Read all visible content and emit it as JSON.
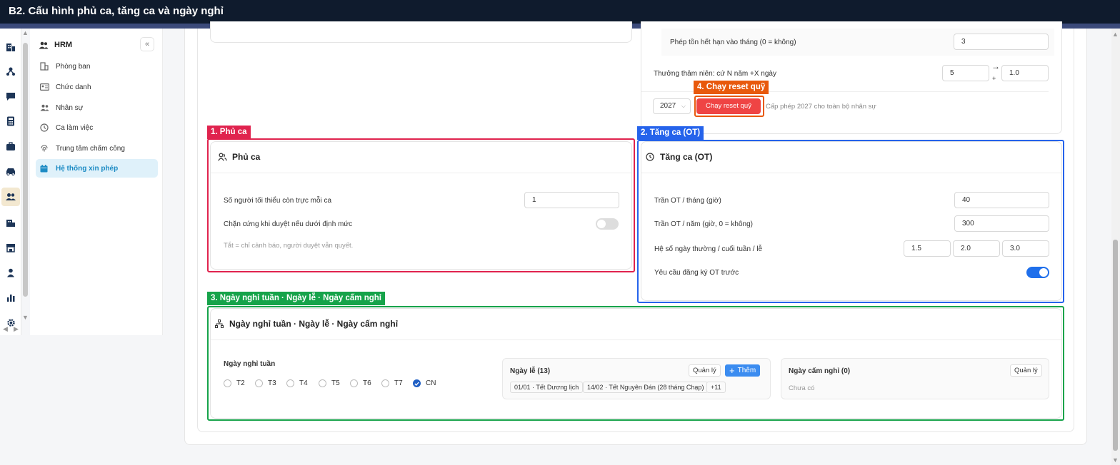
{
  "window": {
    "title": "B2. Cấu hình phủ ca, tăng ca và ngày nghỉ"
  },
  "sidebar": {
    "header": "HRM",
    "items": [
      {
        "label": "Phòng ban"
      },
      {
        "label": "Chức danh"
      },
      {
        "label": "Nhân sự"
      },
      {
        "label": "Ca làm việc"
      },
      {
        "label": "Trung tâm chấm công"
      },
      {
        "label": "Hệ thống xin phép"
      }
    ]
  },
  "top_section": {
    "expire_label": "Phép tồn hết hạn vào tháng (0 = không)",
    "expire_value": "3",
    "seniority_label": "Thưởng thâm niên: cứ N năm +X ngày",
    "seniority_n": "5",
    "seniority_x": "1.0",
    "arrow_symbol": "→",
    "plus_symbol": "+",
    "year_select": "2027",
    "reset_button": "Chạy reset quỹ",
    "reset_hint": "Cấp phép 2027 cho toàn bộ nhân sự"
  },
  "annotations": {
    "a1": "1. Phủ ca",
    "a2": "2. Tăng ca (OT)",
    "a3": "3. Ngày nghỉ tuần · Ngày lễ · Ngày cấm nghỉ",
    "a4": "4. Chạy reset quỹ"
  },
  "coverage": {
    "title": "Phủ ca",
    "min_people_label": "Số người tối thiểu còn trực mỗi ca",
    "min_people_value": "1",
    "hard_block_label": "Chặn cứng khi duyệt nếu dưới định mức",
    "hard_block_on": false,
    "hint": "Tắt = chỉ cảnh báo, người duyệt vẫn quyết."
  },
  "overtime": {
    "title": "Tăng ca (OT)",
    "month_cap_label": "Trần OT / tháng (giờ)",
    "month_cap_value": "40",
    "year_cap_label": "Trần OT / năm (giờ, 0 = không)",
    "year_cap_value": "300",
    "coef_label": "Hệ số ngày thường / cuối tuần / lễ",
    "coef_weekday": "1.5",
    "coef_weekend": "2.0",
    "coef_holiday": "3.0",
    "require_label": "Yêu cầu đăng ký OT trước",
    "require_on": true
  },
  "holidays": {
    "title": "Ngày nghỉ tuần · Ngày lễ · Ngày cấm nghỉ",
    "weekly_label": "Ngày nghỉ tuần",
    "days": [
      {
        "label": "T2",
        "checked": false
      },
      {
        "label": "T3",
        "checked": false
      },
      {
        "label": "T4",
        "checked": false
      },
      {
        "label": "T5",
        "checked": false
      },
      {
        "label": "T6",
        "checked": false
      },
      {
        "label": "T7",
        "checked": false
      },
      {
        "label": "CN",
        "checked": true
      }
    ],
    "holiday_title": "Ngày lễ (13)",
    "manage_label": "Quản lý",
    "add_label": "Thêm",
    "holiday_pills": [
      "01/01 · Tết Dương lịch",
      "14/02 · Tết Nguyên Đán (28 tháng Chạp)",
      "+11"
    ],
    "banned_title": "Ngày cấm nghỉ (0)",
    "banned_manage": "Quản lý",
    "banned_empty": "Chưa có"
  },
  "colors": {
    "annot_red": "#e0234e",
    "annot_blue": "#2563eb",
    "annot_green": "#16a34a",
    "annot_orange": "#e8590c",
    "reset_red": "#ef4444"
  }
}
